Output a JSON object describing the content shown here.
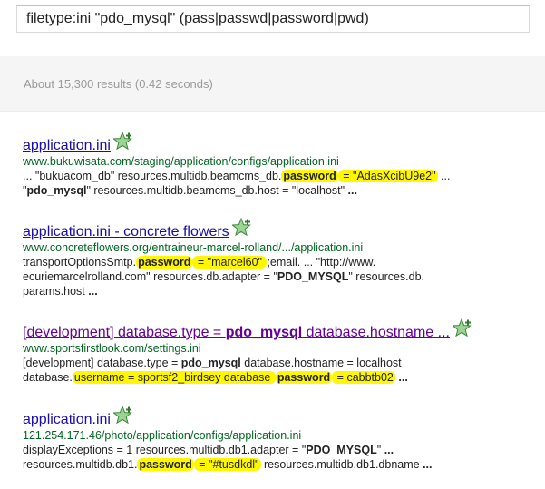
{
  "search": {
    "query": "filetype:ini \"pdo_mysql\" (pass|passwd|password|pwd)"
  },
  "stats": "About 15,300 results (0.42 seconds)",
  "results": [
    {
      "title": "application.ini",
      "url": "www.bukuwisata.com/staging/application/configs/application.ini",
      "line1": [
        {
          "t": "... \"bukuacom_db\" resources.multidb.beamcms_db."
        },
        {
          "t": "password",
          "b": true,
          "h": true
        },
        {
          "t": " = \"AdasXcibU9e2\"",
          "h": true
        },
        {
          "t": " ..."
        }
      ],
      "line2": [
        {
          "t": "\""
        },
        {
          "t": "pdo_mysql",
          "b": true
        },
        {
          "t": "\" resources.multidb.beamcms_db.host = \"localhost\" "
        },
        {
          "t": "...",
          "b": true
        }
      ]
    },
    {
      "title": "application.ini - concrete flowers",
      "url": "www.concreteflowers.org/entraineur-marcel-rolland/.../application.ini",
      "line1": [
        {
          "t": "transportOptionsSmtp."
        },
        {
          "t": "password",
          "b": true,
          "h": true
        },
        {
          "t": " = \"marcel60\" ",
          "h": true
        },
        {
          "t": ";email. ... \"http://www."
        }
      ],
      "line2": [
        {
          "t": "ecuriemarcelrolland.com\" resources.db.adapter = \""
        },
        {
          "t": "PDO_MYSQL",
          "b": true
        },
        {
          "t": "\" resources.db."
        }
      ],
      "line3": [
        {
          "t": "params.host "
        },
        {
          "t": "...",
          "b": true
        }
      ]
    },
    {
      "title_parts": [
        {
          "t": "[development] database.type = "
        },
        {
          "t": "pdo_mysql",
          "b": true
        },
        {
          "t": " database.hostname ..."
        }
      ],
      "url": "www.sportsfirstlook.com/settings.ini",
      "line1": [
        {
          "t": "[development] database.type = "
        },
        {
          "t": "pdo_mysql",
          "b": true
        },
        {
          "t": " database.hostname = localhost"
        }
      ],
      "line2": [
        {
          "t": "database."
        },
        {
          "t": "username = sportsf2_birdsey database ",
          "h": true
        },
        {
          "t": "password",
          "b": true,
          "h": true
        },
        {
          "t": " = cabbtb02",
          "h": true
        },
        {
          "t": " "
        },
        {
          "t": "...",
          "b": true
        }
      ]
    },
    {
      "title": "application.ini",
      "url": "121.254.171.46/photo/application/configs/application.ini",
      "line1": [
        {
          "t": "displayExceptions = 1 resources.multidb.db1.adapter = \""
        },
        {
          "t": "PDO_MYSQL",
          "b": true
        },
        {
          "t": "\" "
        },
        {
          "t": "...",
          "b": true
        }
      ],
      "line2": [
        {
          "t": "resources.multidb.db1."
        },
        {
          "t": "password",
          "b": true,
          "h": true
        },
        {
          "t": " = \"#tusdkdl\"",
          "h": true
        },
        {
          "t": " resources.multidb.db1.dbname "
        },
        {
          "t": "...",
          "b": true
        }
      ]
    }
  ],
  "icons": {
    "star": "plus-star-icon",
    "star_color": "#4caf50",
    "highlight_color": "#fff700"
  }
}
